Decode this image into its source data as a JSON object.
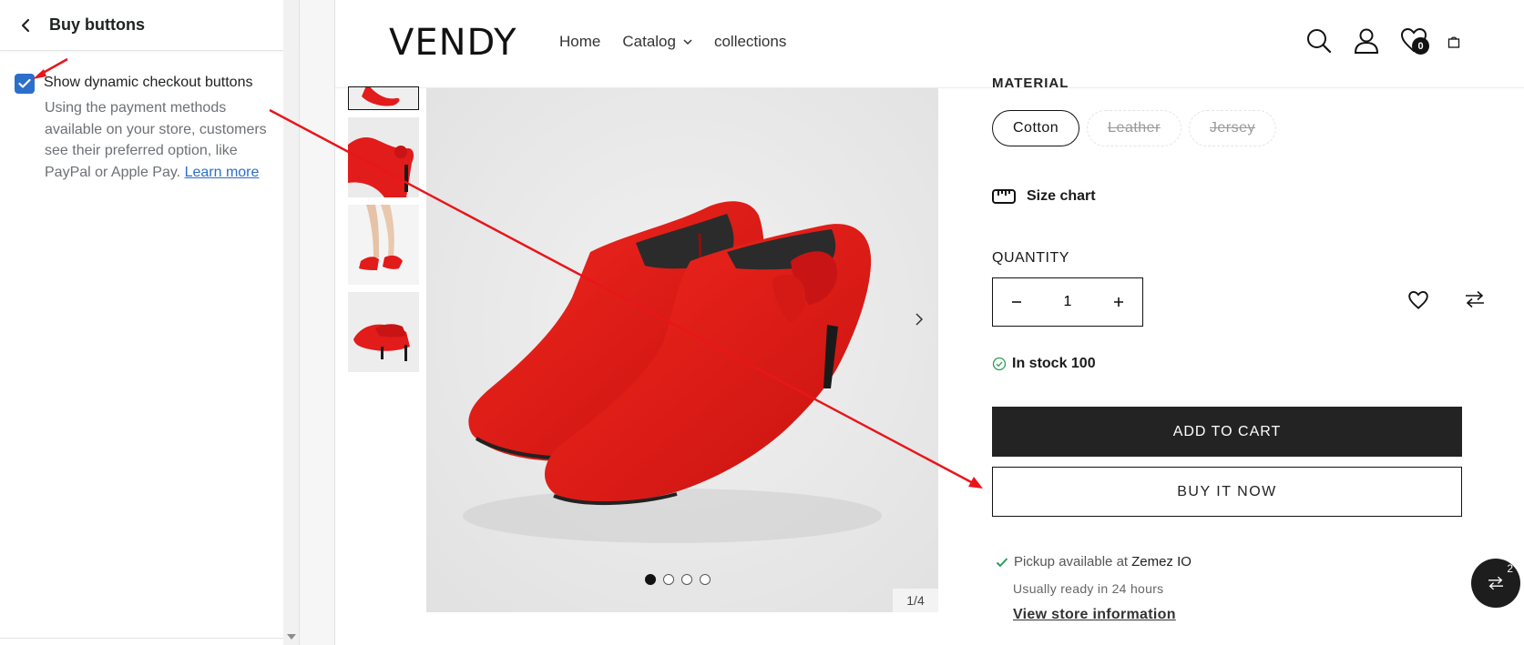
{
  "panel": {
    "title": "Buy buttons",
    "setting_label": "Show dynamic checkout buttons",
    "setting_help": "Using the payment methods available on your store, customers see their preferred option, like PayPal or Apple Pay.",
    "learn_more": "Learn more",
    "checked": true
  },
  "header": {
    "logo": "VENDY",
    "nav": [
      "Home",
      "Catalog",
      "collections"
    ],
    "wishlist_count": "0"
  },
  "gallery": {
    "counter": "1/4",
    "slides": 4,
    "active_slide": 1
  },
  "product": {
    "material_label": "MATERIAL",
    "materials": [
      {
        "label": "Cotton",
        "state": "selected"
      },
      {
        "label": "Leather",
        "state": "disabled"
      },
      {
        "label": "Jersey",
        "state": "disabled"
      }
    ],
    "size_chart": "Size chart",
    "quantity_label": "QUANTITY",
    "quantity": "1",
    "stock": "In stock 100",
    "add_to_cart": "ADD TO CART",
    "buy_now": "BUY IT NOW",
    "pickup_prefix": "Pickup available at",
    "pickup_location": "Zemez IO",
    "ready": "Usually ready in 24 hours",
    "store_link": "View store information"
  },
  "fab": {
    "count": "2"
  },
  "colors": {
    "accent": "#2c6ecb",
    "annotation": "#e8161b",
    "button_dark": "#232323",
    "product_red": "#e21b1b"
  }
}
